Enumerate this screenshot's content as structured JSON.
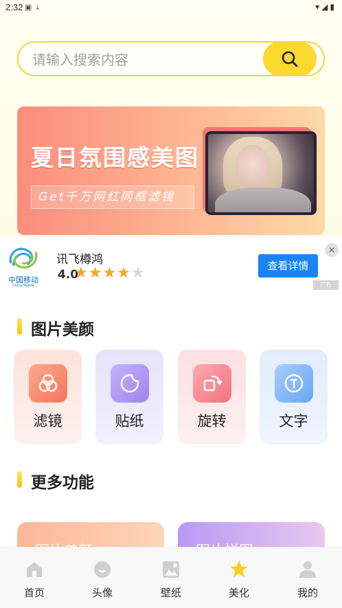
{
  "status_bar": {
    "time": "2:32",
    "left_icons": [
      "android-icon",
      "download-icon"
    ],
    "right_icons": [
      "wifi-icon",
      "signal-icon",
      "battery-icon"
    ]
  },
  "search": {
    "placeholder": "请输入搜索内容",
    "button_icon": "search-icon",
    "accent_color": "#fbd92f"
  },
  "banner": {
    "title": "夏日氛围感美图",
    "subtitle": "Get千万网红同框滤镜"
  },
  "ad": {
    "logo_text": "中国移动",
    "logo_sub": "China Mobile",
    "app_name": "讯飞樽鸿",
    "rating": "4.0",
    "stars_filled": 4,
    "stars_total": 5,
    "button_label": "查看详情",
    "tag": "广告",
    "button_color": "#1a84f5"
  },
  "sections": {
    "beauty_title": "图片美颜",
    "more_title": "更多功能"
  },
  "features": [
    {
      "label": "滤镜",
      "icon": "filter-icon"
    },
    {
      "label": "贴纸",
      "icon": "sticker-icon"
    },
    {
      "label": "旋转",
      "icon": "rotate-icon"
    },
    {
      "label": "文字",
      "icon": "text-icon"
    }
  ],
  "more_cards": [
    {
      "label": "图片美颜"
    },
    {
      "label": "图片拼图"
    }
  ],
  "tabs": [
    {
      "label": "首页",
      "icon": "home-icon"
    },
    {
      "label": "头像",
      "icon": "avatar-icon"
    },
    {
      "label": "壁纸",
      "icon": "wallpaper-icon"
    },
    {
      "label": "美化",
      "icon": "star-icon",
      "active": true
    },
    {
      "label": "我的",
      "icon": "profile-icon"
    }
  ]
}
